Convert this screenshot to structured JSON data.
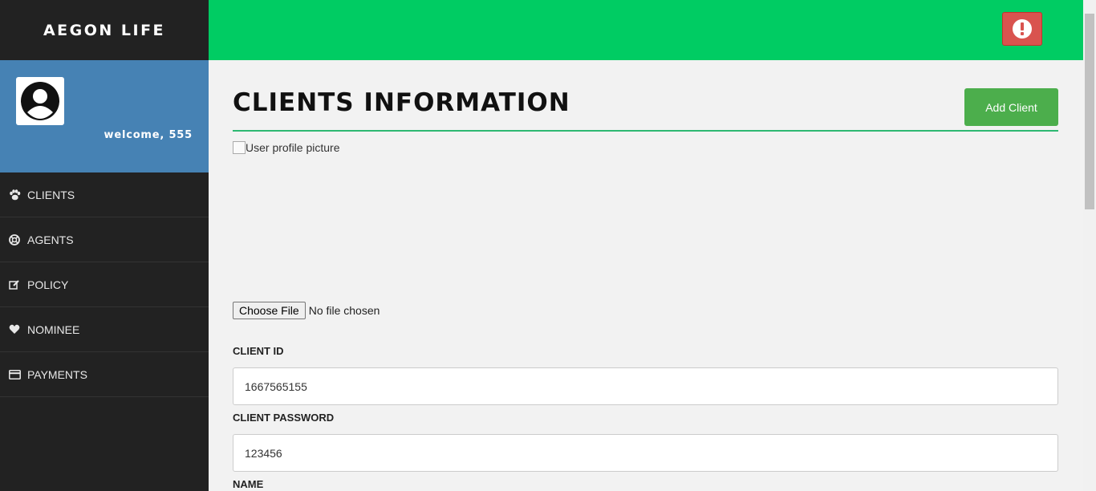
{
  "app": {
    "brand": "AEGON LIFE",
    "welcome": "welcome, 555"
  },
  "sidebar": {
    "items": [
      {
        "label": "CLIENTS",
        "icon": "paw-icon"
      },
      {
        "label": "AGENTS",
        "icon": "life-ring-icon"
      },
      {
        "label": "POLICY",
        "icon": "edit-icon"
      },
      {
        "label": "NOMINEE",
        "icon": "heart-icon"
      },
      {
        "label": "PAYMENTS",
        "icon": "credit-card-icon"
      }
    ]
  },
  "header": {
    "alert_icon": "exclamation-circle-icon"
  },
  "main": {
    "title": "CLIENTS INFORMATION",
    "add_button": "Add Client",
    "profile_img_alt": "User profile picture",
    "file_button": "Choose File",
    "file_status": "No file chosen",
    "fields": [
      {
        "label": "CLIENT ID",
        "value": "1667565155"
      },
      {
        "label": "CLIENT PASSWORD",
        "value": "123456"
      },
      {
        "label": "NAME",
        "value": ""
      }
    ]
  },
  "colors": {
    "sidebar": "#222222",
    "profile": "#4682b4",
    "topbar": "#00cc63",
    "alert": "#d9534f",
    "accent": "#4cae4c"
  }
}
